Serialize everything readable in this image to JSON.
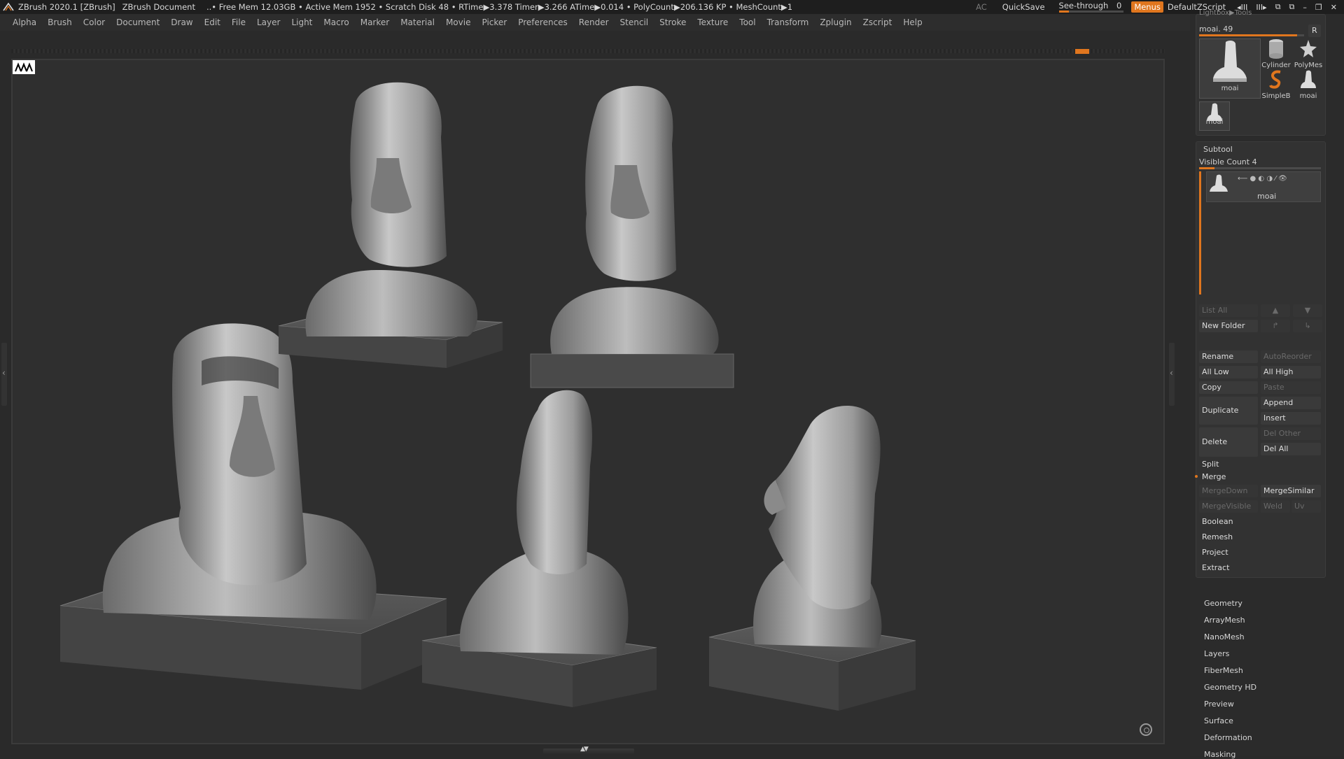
{
  "app": {
    "title": "ZBrush 2020.1 [ZBrush]",
    "document": "ZBrush Document",
    "stats": "..• Free Mem 12.03GB • Active Mem 1952 • Scratch Disk 48 •  RTime▶3.378 Timer▶3.266 ATime▶0.014 • PolyCount▶206.136 KP  • MeshCount▶1"
  },
  "topright": {
    "ac": "AC",
    "quicksave": "QuickSave",
    "see_through_label": "See-through",
    "see_through_value": "0",
    "see_through_level": 0.15,
    "menus": "Menus",
    "script": "DefaultZScript"
  },
  "menubar": [
    "Alpha",
    "Brush",
    "Color",
    "Document",
    "Draw",
    "Edit",
    "File",
    "Layer",
    "Light",
    "Macro",
    "Marker",
    "Material",
    "Movie",
    "Picker",
    "Preferences",
    "Render",
    "Stencil",
    "Stroke",
    "Texture",
    "Tool",
    "Transform",
    "Zplugin",
    "Zscript",
    "Help"
  ],
  "colors": {
    "accent": "#e0761e",
    "panel": "#323232",
    "button": "#3a3a3a"
  },
  "tool_panel": {
    "header": "Lightbox▶Tools",
    "current_tool": "moai. 49",
    "r_button": "R",
    "tools": [
      {
        "label": "moai",
        "icon": "moai-icon"
      },
      {
        "label": "Cylinder",
        "icon": "cylinder-icon"
      },
      {
        "label": "PolyMes",
        "icon": "polymesh-star-icon"
      },
      {
        "label": "SimpleB",
        "icon": "simplebrush-icon"
      },
      {
        "label": "moai",
        "icon": "moai-icon"
      },
      {
        "label": "moai",
        "icon": "moai-icon"
      }
    ]
  },
  "subtool": {
    "title": "Subtool",
    "visible_count": "Visible Count 4",
    "item_label": "moai",
    "list_all": "List All",
    "new_folder": "New Folder",
    "rename": "Rename",
    "auto_reorder": "AutoReorder",
    "all_low": "All Low",
    "all_high": "All High",
    "copy": "Copy",
    "paste": "Paste",
    "duplicate": "Duplicate",
    "append": "Append",
    "insert": "Insert",
    "delete": "Delete",
    "del_other": "Del Other",
    "del_all": "Del All",
    "split": "Split",
    "merge": "Merge",
    "merge_down": "MergeDown",
    "merge_similar": "MergeSimilar",
    "merge_visible": "MergeVisible",
    "weld": "Weld",
    "uv": "Uv",
    "boolean": "Boolean",
    "remesh": "Remesh",
    "project": "Project",
    "extract": "Extract"
  },
  "tool_menus": [
    "Geometry",
    "ArrayMesh",
    "NanoMesh",
    "Layers",
    "FiberMesh",
    "Geometry HD",
    "Preview",
    "Surface",
    "Deformation",
    "Masking"
  ]
}
